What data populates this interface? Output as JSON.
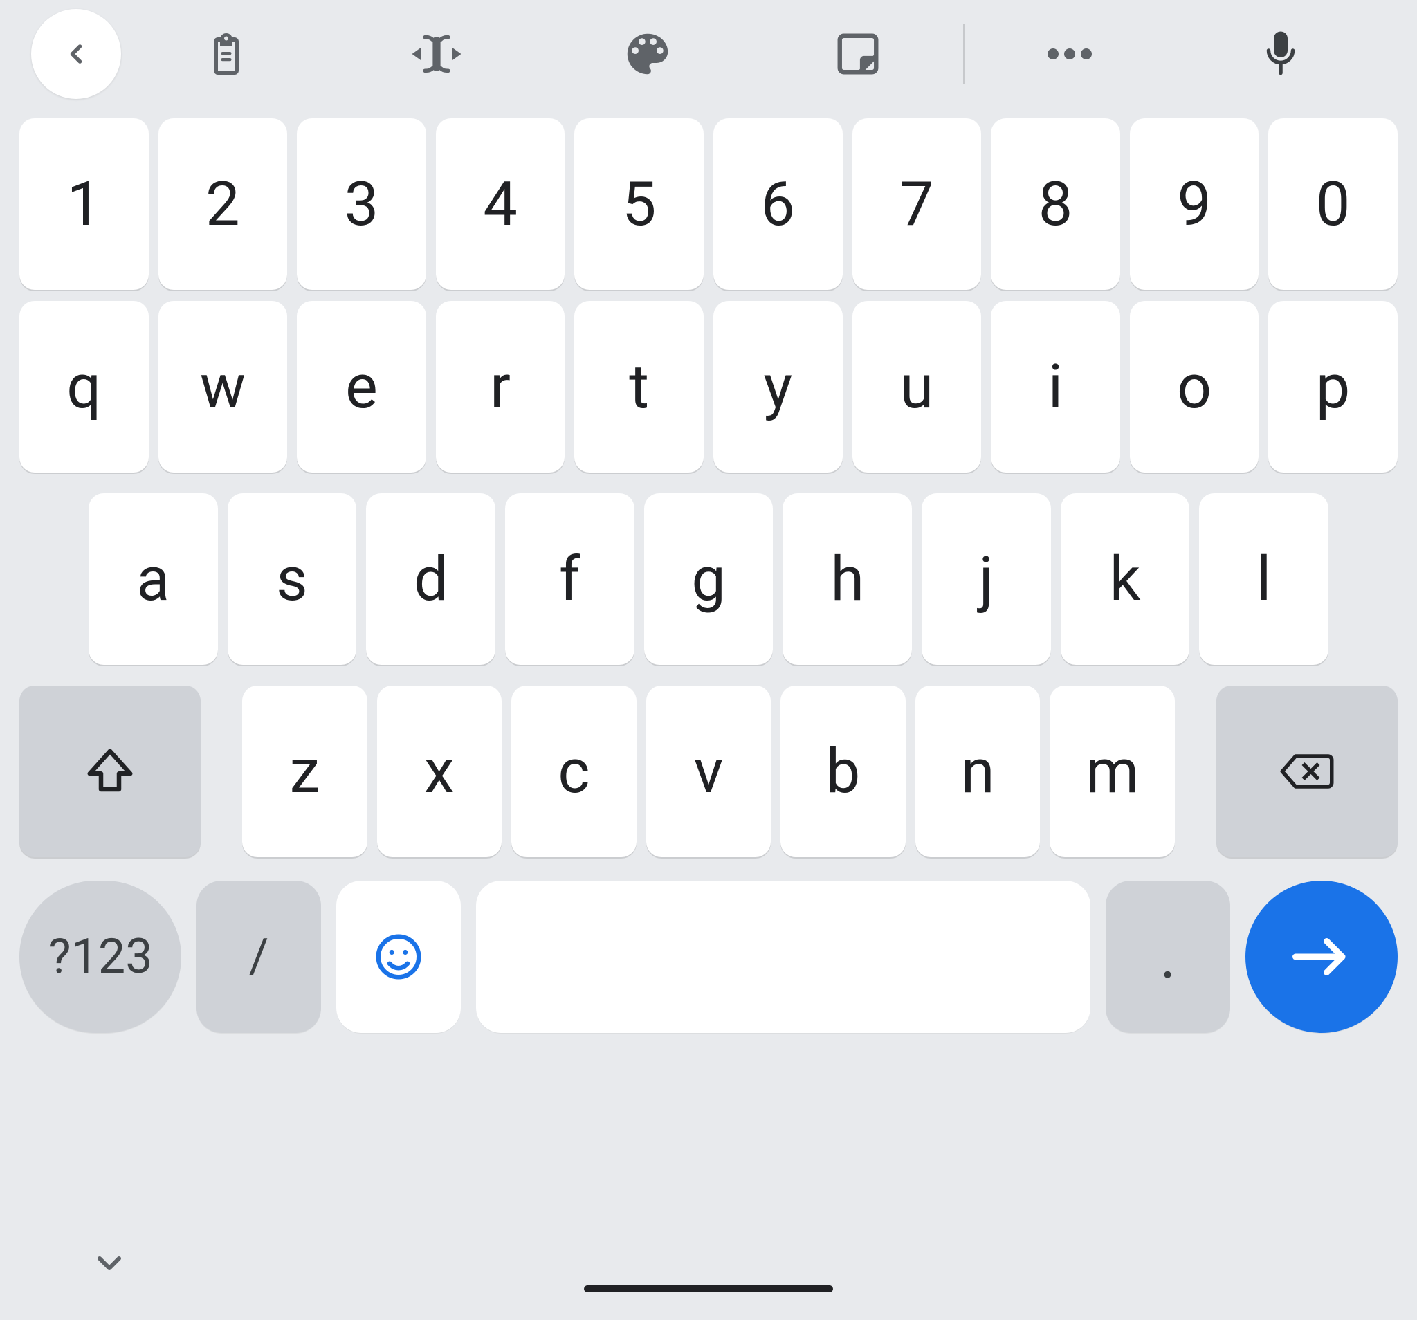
{
  "toolbar": {
    "icons": [
      "back",
      "clipboard",
      "text-cursor",
      "palette",
      "sticker",
      "more",
      "mic"
    ]
  },
  "rows": {
    "numbers": [
      "1",
      "2",
      "3",
      "4",
      "5",
      "6",
      "7",
      "8",
      "9",
      "0"
    ],
    "top": [
      "q",
      "w",
      "e",
      "r",
      "t",
      "y",
      "u",
      "i",
      "o",
      "p"
    ],
    "home": [
      "a",
      "s",
      "d",
      "f",
      "g",
      "h",
      "j",
      "k",
      "l"
    ],
    "bottom": [
      "z",
      "x",
      "c",
      "v",
      "b",
      "n",
      "m"
    ]
  },
  "mods": {
    "shift": "shift",
    "backspace": "backspace"
  },
  "bottom_bar": {
    "symbols_label": "?123",
    "slash": "/",
    "period": ".",
    "emoji_color": "#1a73e8",
    "go_color": "#1a73e8"
  }
}
